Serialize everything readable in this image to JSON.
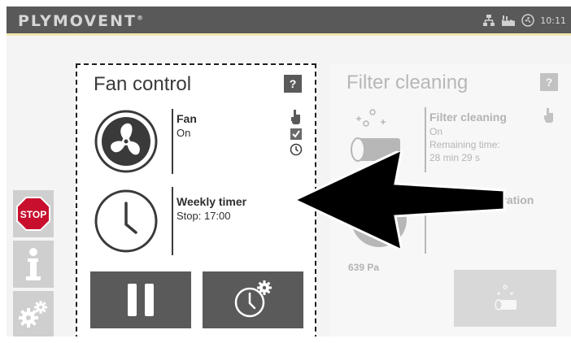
{
  "header": {
    "brand": "PLYMOVENT",
    "trademark": "®",
    "time": "10:11",
    "status_icons": [
      "network-icon",
      "factory-icon",
      "fan-status-icon"
    ]
  },
  "sidebar": {
    "items": [
      {
        "name": "stop",
        "label": "STOP",
        "icon": "stop-icon"
      },
      {
        "name": "info",
        "icon": "info-icon"
      },
      {
        "name": "settings",
        "icon": "gears-icon"
      }
    ]
  },
  "fan_card": {
    "title": "Fan control",
    "help": "?",
    "fan": {
      "label": "Fan",
      "value": "On"
    },
    "timer": {
      "label": "Weekly timer",
      "value": "Stop: 17:00"
    },
    "buttons": [
      "pause-button",
      "timer-settings-button"
    ]
  },
  "filter_card": {
    "title": "Filter cleaning",
    "help": "?",
    "status": {
      "label": "Filter cleaning",
      "value": "On",
      "remaining_label": "Remaining time:",
      "remaining_value": "28 min 29 s"
    },
    "activation": {
      "label": "Cleaning activation"
    },
    "pressure": "639 Pa"
  },
  "colors": {
    "topbar": "#595959",
    "accent_line": "#f2e6b0",
    "button": "#5a5a5a",
    "stop_red": "#c8102e"
  }
}
